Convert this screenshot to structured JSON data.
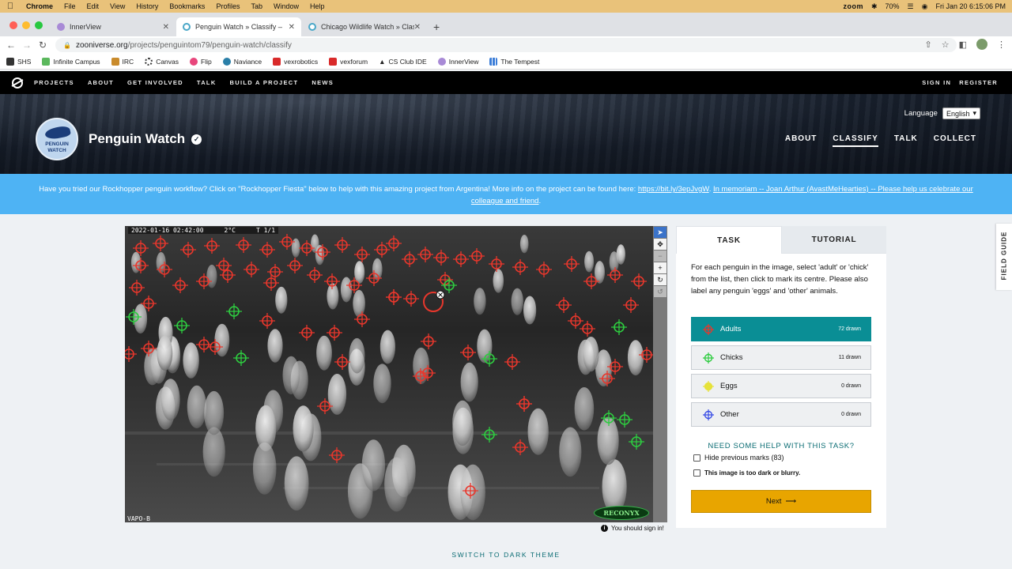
{
  "macos": {
    "menu": [
      "Chrome",
      "File",
      "Edit",
      "View",
      "History",
      "Bookmarks",
      "Profiles",
      "Tab",
      "Window",
      "Help"
    ],
    "status": {
      "zoom": "zoom",
      "battery": "70%",
      "datetime": "Fri Jan 20  6:15:06 PM"
    }
  },
  "browser": {
    "tabs": [
      {
        "title": "InnerView",
        "active": false
      },
      {
        "title": "Penguin Watch » Classify — Zo",
        "active": true
      },
      {
        "title": "Chicago Wildlife Watch » Class",
        "active": false
      }
    ],
    "url_host": "zooniverse.org",
    "url_path": "/projects/penguintom79/penguin-watch/classify",
    "bookmarks": [
      "SHS",
      "Infinite Campus",
      "IRC",
      "Canvas",
      "Flip",
      "Naviance",
      "vexrobotics",
      "vexforum",
      "CS Club IDE",
      "InnerView",
      "The Tempest"
    ]
  },
  "zooniverse_nav": {
    "links": [
      "PROJECTS",
      "ABOUT",
      "GET INVOLVED",
      "TALK",
      "BUILD A PROJECT",
      "NEWS"
    ],
    "sign_in": "SIGN IN",
    "register": "REGISTER"
  },
  "project": {
    "logo_text_1": "PENGUIN",
    "logo_text_2": "WATCH",
    "title": "Penguin Watch",
    "language_label": "Language",
    "language_value": "English",
    "nav": [
      "ABOUT",
      "CLASSIFY",
      "TALK",
      "COLLECT"
    ],
    "active_nav": "CLASSIFY"
  },
  "banner": {
    "text": "Have you tried our Rockhopper penguin workflow? Click on \"Rockhopper Fiesta\" below to help with this amazing project from Argentina! More info on the project can be found here: ",
    "link": "https://bit.ly/3epJvgW",
    "sep": ". ",
    "memoriam": "In memoriam -- Joan Arthur (AvastMeHearties) -- Please help us celebrate our colleague and friend",
    "tail": "."
  },
  "subject": {
    "timestamp": "2022-01-16 02:42:00",
    "temperature": "2°C",
    "trigger": "T 1/1",
    "camera": "VAPO-B",
    "brand": "RECONYX"
  },
  "signin_notice": "You should sign in!",
  "task": {
    "tab_task": "TASK",
    "tab_tutorial": "TUTORIAL",
    "instruction": "For each penguin in the image, select 'adult' or 'chick' from the list, then click to mark its centre. Please also label any penguin 'eggs' and 'other' animals.",
    "options": [
      {
        "label": "Adults",
        "count": "72 drawn",
        "color": "#e8372c",
        "selected": true
      },
      {
        "label": "Chicks",
        "count": "11 drawn",
        "color": "#2ecc40",
        "selected": false
      },
      {
        "label": "Eggs",
        "count": "0 drawn",
        "color": "#e6e23a",
        "selected": false
      },
      {
        "label": "Other",
        "count": "0 drawn",
        "color": "#3a4ee6",
        "selected": false
      }
    ],
    "help_heading": "NEED SOME HELP WITH THIS TASK?",
    "hide_marks": "Hide previous marks (83)",
    "too_dark": "This image is too dark or blurry.",
    "next": "Next"
  },
  "field_guide": "FIELD GUIDE",
  "dark_theme": "SWITCH TO DARK THEME",
  "colors": {
    "teal": "#0a8e95",
    "banner": "#4eb3f4",
    "next": "#e8a500",
    "adult_mark": "#e8372c",
    "chick_mark": "#2ecc40"
  }
}
